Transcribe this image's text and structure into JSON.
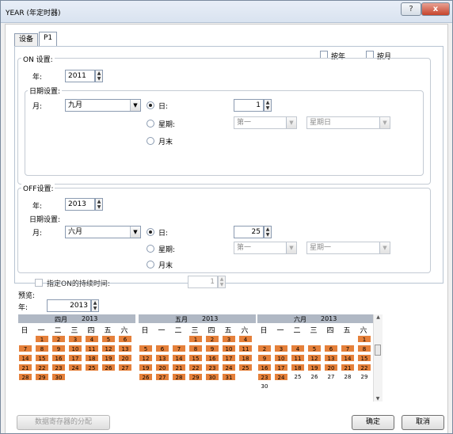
{
  "window": {
    "title": "YEAR (年定时器)",
    "help": "?",
    "close": "x"
  },
  "tabs": [
    "设备",
    "P1"
  ],
  "top_checks": {
    "by_year": "按年",
    "by_month": "按月"
  },
  "on": {
    "group": "ON 设置:",
    "year_label": "年:",
    "year": "2011",
    "date_group": "日期设置:",
    "month_label": "月:",
    "month": "九月",
    "day_label": "日:",
    "day": "1",
    "week_label": "星期:",
    "week_sel": "第一",
    "weekday_sel": "星期日",
    "month_end": "月末"
  },
  "off": {
    "group": "OFF设置:",
    "year_label": "年:",
    "year": "2013",
    "date_group": "日期设置:",
    "month_label": "月:",
    "month": "六月",
    "day_label": "日:",
    "day": "25",
    "week_label": "星期:",
    "week_sel": "第一",
    "weekday_sel": "星期一",
    "month_end": "月末"
  },
  "duration": {
    "label": "指定ON的持续时间:",
    "value": "1"
  },
  "preview": {
    "label": "预览:",
    "year_label": "年:",
    "year": "2013"
  },
  "calendars": [
    {
      "month": "四月",
      "year": "2013",
      "weekdays": [
        "日",
        "一",
        "二",
        "三",
        "四",
        "五",
        "六"
      ],
      "start": 1,
      "days": 30,
      "hl_to": 30,
      "prev_tail": [],
      "next_head": []
    },
    {
      "month": "五月",
      "year": "2013",
      "weekdays": [
        "日",
        "一",
        "二",
        "三",
        "四",
        "五",
        "六"
      ],
      "start": 3,
      "days": 31,
      "hl_to": 31,
      "prev_tail": [],
      "next_head": []
    },
    {
      "month": "六月",
      "year": "2013",
      "weekdays": [
        "日",
        "一",
        "二",
        "三",
        "四",
        "五",
        "六"
      ],
      "start": 6,
      "days": 30,
      "hl_to": 24,
      "prev_tail": [],
      "next_head": []
    }
  ],
  "buttons": {
    "data_reg": "数据寄存器的分配",
    "ok": "确定",
    "cancel": "取消"
  },
  "colors": {
    "highlight": "#e5803a"
  }
}
